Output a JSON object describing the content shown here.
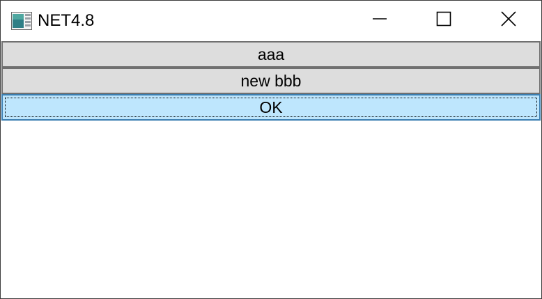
{
  "window": {
    "title": "NET4.8",
    "icon": "app-window-icon",
    "controls": {
      "minimize_icon": "minimize-icon",
      "maximize_icon": "maximize-icon",
      "close_icon": "close-icon"
    }
  },
  "buttons": [
    {
      "label": "aaa"
    },
    {
      "label": "new bbb"
    },
    {
      "label": "OK",
      "focused": true
    }
  ],
  "colors": {
    "button_bg": "#dddddd",
    "button_border": "#707070",
    "focused_bg": "#bee6fd",
    "focused_border": "#3c7fb1"
  }
}
